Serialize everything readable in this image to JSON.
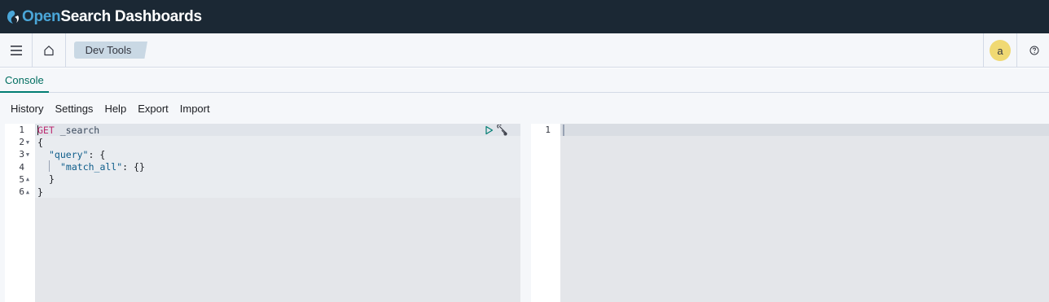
{
  "brand": {
    "name_open": "Open",
    "name_rest": "Search Dashboards"
  },
  "header": {
    "breadcrumb": "Dev Tools",
    "avatar_initial": "a",
    "icons": {
      "menu": "hamburger-menu-icon",
      "home": "home-icon",
      "help": "help-circle-icon"
    },
    "avatar_color": "#f0d973"
  },
  "tabs": [
    {
      "label": "Console",
      "active": true
    }
  ],
  "menu": {
    "items": [
      "History",
      "Settings",
      "Help",
      "Export",
      "Import"
    ]
  },
  "request_editor": {
    "line_numbers": [
      "1",
      "2",
      "3",
      "4",
      "5",
      "6"
    ],
    "lines": {
      "l1_method": "GET",
      "l1_url": " _search",
      "l2": "{",
      "l3_key": "\"query\"",
      "l3_rest": ": {",
      "l4_key": "\"match_all\"",
      "l4_rest": ": {}",
      "l5": "}",
      "l6": "}"
    },
    "action_icons": [
      "play-icon",
      "wrench-icon"
    ]
  },
  "response_editor": {
    "line_numbers": [
      "1"
    ]
  },
  "colors": {
    "topbar": "#1b2834",
    "brand_accent": "#4aa6d8",
    "tab_active": "#016e60",
    "method": "#bd2c71",
    "json_key": "#0d5c8a"
  }
}
